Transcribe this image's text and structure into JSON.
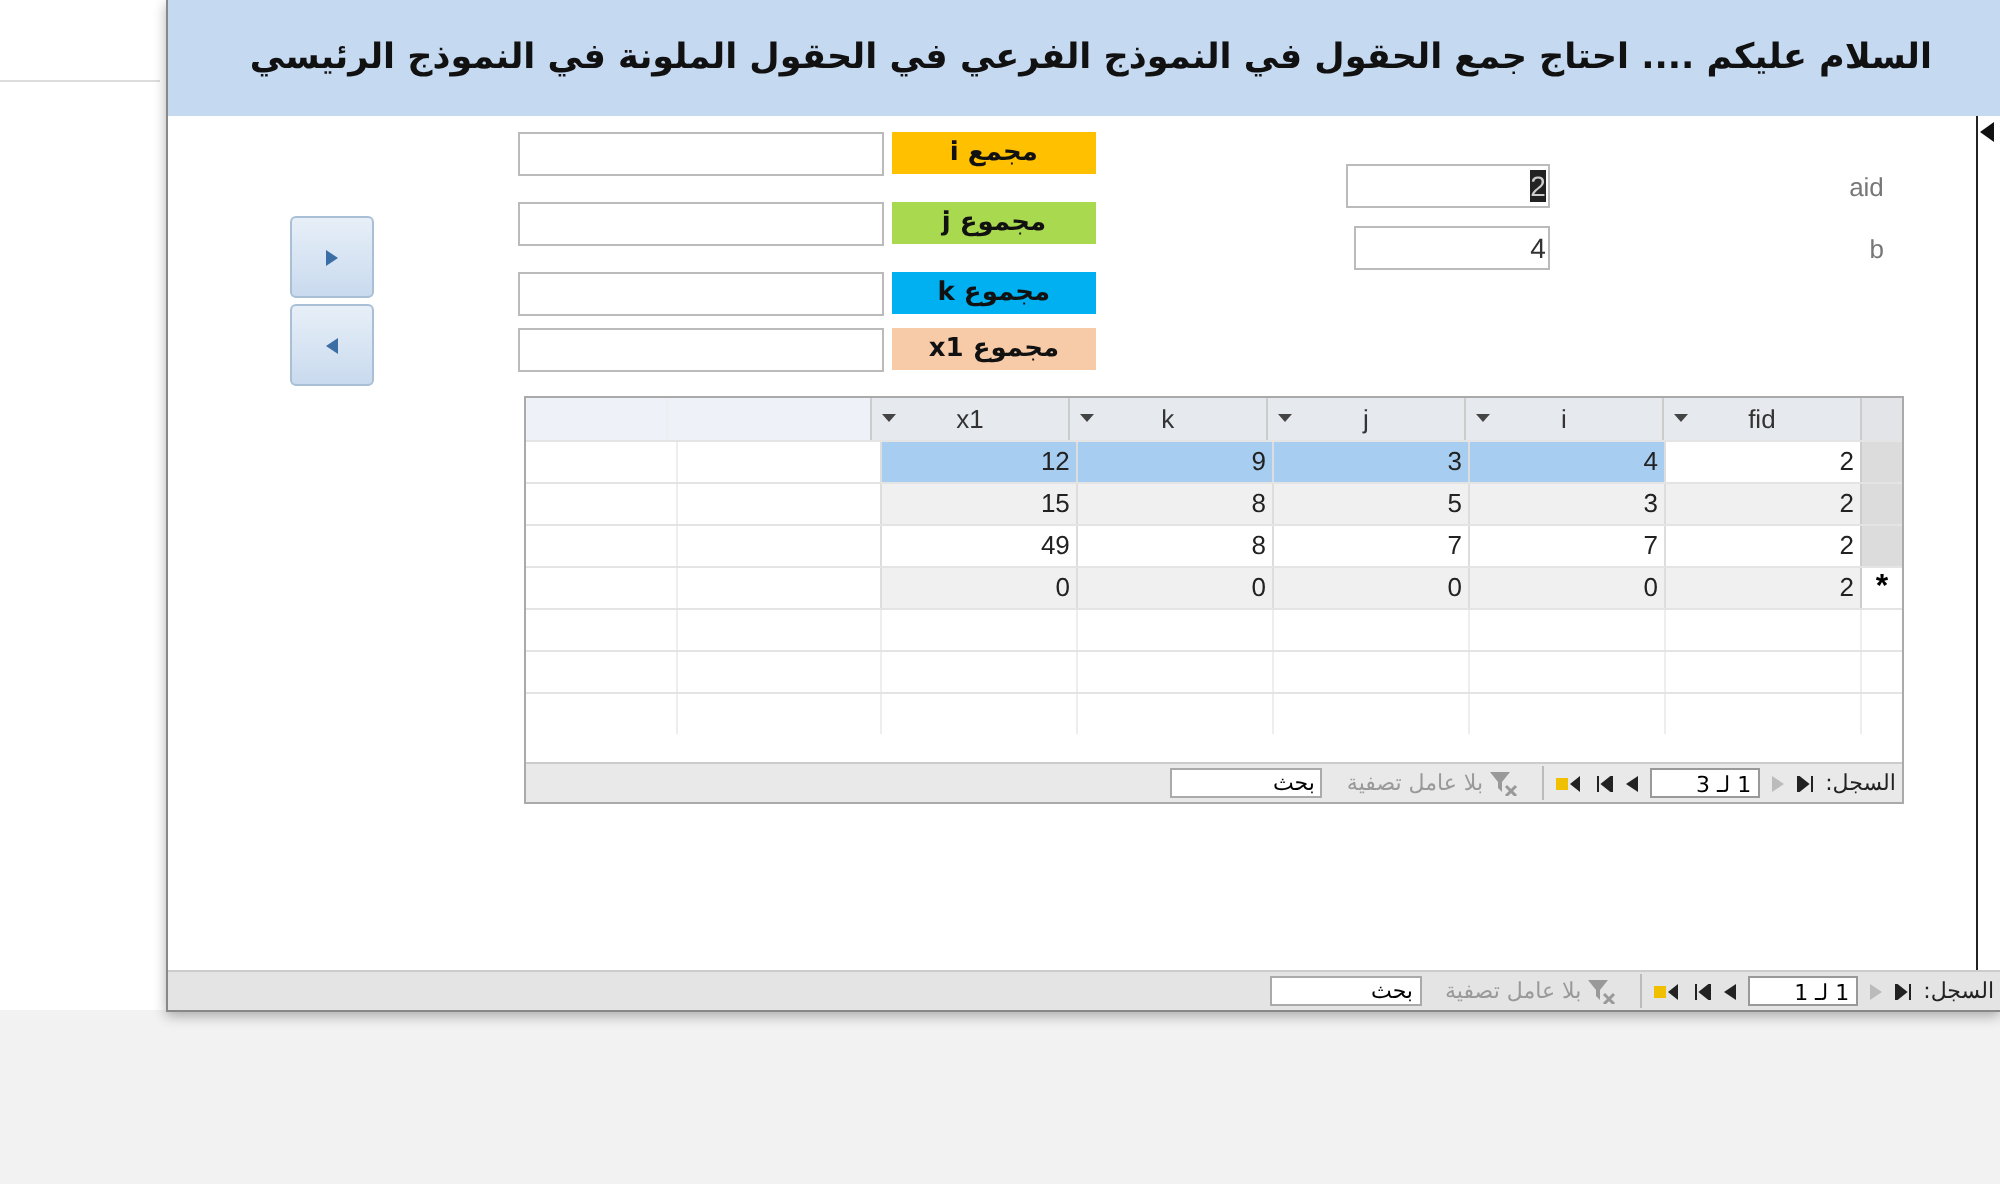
{
  "window": {
    "title": "السلام عليكم .... احتاج جمع الحقول في النموذج الفرعي في الحقول الملونة في النموذج الرئيسي"
  },
  "sum_fields": [
    {
      "label": "مجمع i",
      "color": "#ffc000"
    },
    {
      "label": "مجموع j",
      "color": "#a9d94f"
    },
    {
      "label": "مجموع k",
      "color": "#00b0f0"
    },
    {
      "label": "مجموع x1",
      "color": "#f8cba8"
    }
  ],
  "fields": [
    {
      "label": "aid",
      "value": "2",
      "text_selected": true
    },
    {
      "label": "b",
      "value": "4",
      "text_selected": false
    }
  ],
  "subform": {
    "columns": [
      "fid",
      "i",
      "j",
      "k",
      "x1"
    ],
    "rows": [
      {
        "cells": [
          "2",
          "4",
          "3",
          "9",
          "12"
        ],
        "selected": true
      },
      {
        "cells": [
          "2",
          "3",
          "5",
          "8",
          "15"
        ],
        "selected": false
      },
      {
        "cells": [
          "2",
          "7",
          "7",
          "8",
          "49"
        ],
        "selected": false
      },
      {
        "cells": [
          "2",
          "0",
          "0",
          "0",
          "0"
        ],
        "selected": false,
        "selector": "*"
      }
    ],
    "navigation": {
      "label": "السجل:",
      "record": "1 لـ 3",
      "prev_disabled": true,
      "filter": "بلا عامل تصفية",
      "search": "بحث"
    }
  },
  "navigation": {
    "label": "السجل:",
    "record": "1 لـ 1",
    "prev_disabled": true,
    "filter": "بلا عامل تصفية",
    "search": "بحث"
  }
}
